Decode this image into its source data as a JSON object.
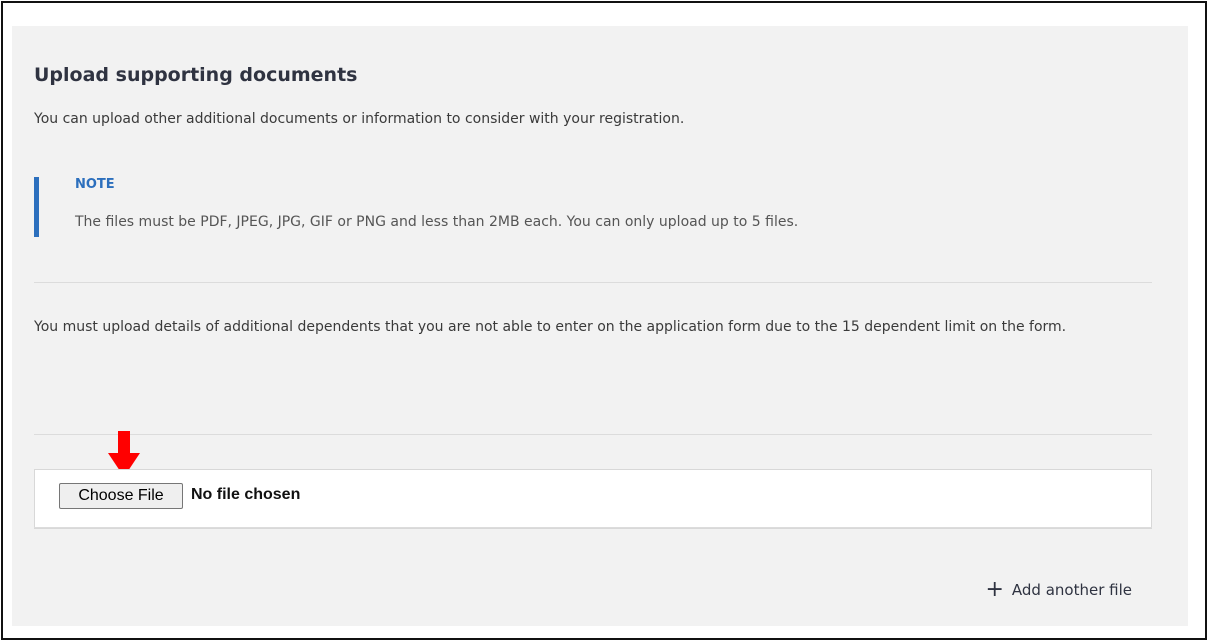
{
  "section": {
    "title": "Upload supporting documents",
    "intro": "You can upload other additional documents or information to consider with your registration."
  },
  "note": {
    "title": "NOTE",
    "body": "The files must be PDF, JPEG, JPG, GIF or PNG and less than 2MB each. You can only upload up to 5 files."
  },
  "dependents_text": "You must upload details of additional dependents that you are not able to enter on the application form due to the 15 dependent limit on the form.",
  "file_input": {
    "button_label": "Choose File",
    "status": "No file chosen"
  },
  "add_file": {
    "icon": "plus-icon",
    "label": "Add another file"
  },
  "colors": {
    "accent": "#2c6fbd",
    "panel": "#f2f2f2",
    "arrow": "#ff0000"
  }
}
